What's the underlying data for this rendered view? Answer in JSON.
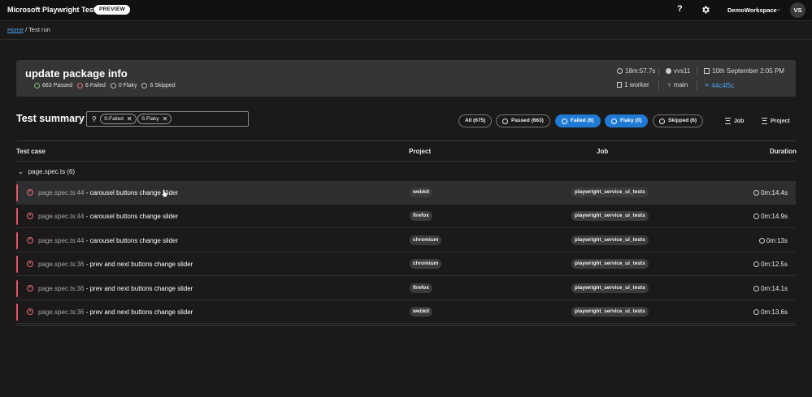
{
  "header": {
    "brand": "Microsoft Playwright Testing",
    "preview_badge": "PREVIEW",
    "help": "?",
    "workspace": "DemoWorkspace",
    "avatar": "VS"
  },
  "breadcrumb": {
    "home": "Home",
    "separator": "/",
    "current": "Test run"
  },
  "run": {
    "title": "update package info",
    "passed": "663 Passed",
    "failed": "6 Failed",
    "flaky": "0 Flaky",
    "skipped": "6 Skipped",
    "duration": "18m:57.7s",
    "user": "vvs11",
    "date": "10th September 2:05 PM",
    "workers": "1 worker",
    "branch": "main",
    "commit": "44c4f5c"
  },
  "summary": {
    "title": "Test summary",
    "filter_chips": [
      "S:Failed",
      "S:Flaky"
    ],
    "status_pills": [
      {
        "label": "All (675)",
        "active": false
      },
      {
        "label": "Passed (663)",
        "active": false
      },
      {
        "label": "Failed (6)",
        "active": true
      },
      {
        "label": "Flaky (0)",
        "active": true
      },
      {
        "label": "Skipped (6)",
        "active": false
      }
    ],
    "group_job": "Job",
    "group_project": "Project"
  },
  "table": {
    "headers": {
      "test_case": "Test case",
      "project": "Project",
      "job": "Job",
      "duration": "Duration"
    },
    "group_label": "page.spec.ts (6)",
    "rows": [
      {
        "file": "page.spec.ts:44",
        "sep": " - ",
        "title": "carousel buttons change slider",
        "project": "webkit",
        "job": "playwright_service_ui_tests",
        "duration": "0m:14.4s"
      },
      {
        "file": "page.spec.ts:44",
        "sep": " - ",
        "title": "carousel buttons change slider",
        "project": "firefox",
        "job": "playwright_service_ui_tests",
        "duration": "0m:14.9s"
      },
      {
        "file": "page.spec.ts:44",
        "sep": " - ",
        "title": "carousel buttons change slider",
        "project": "chromium",
        "job": "playwright_service_ui_tests",
        "duration": "0m:13s"
      },
      {
        "file": "page.spec.ts:36",
        "sep": " - ",
        "title": "prev and next buttons change slider",
        "project": "chromium",
        "job": "playwright_service_ui_tests",
        "duration": "0m:12.5s"
      },
      {
        "file": "page.spec.ts:36",
        "sep": " - ",
        "title": "prev and next buttons change slider",
        "project": "firefox",
        "job": "playwright_service_ui_tests",
        "duration": "0m:14.1s"
      },
      {
        "file": "page.spec.ts:36",
        "sep": " - ",
        "title": "prev and next buttons change slider",
        "project": "webkit",
        "job": "playwright_service_ui_tests",
        "duration": "0m:13.6s"
      }
    ]
  },
  "colors": {
    "accent": "#1f7ad6",
    "fail": "#e0556a",
    "link": "#4aa3f0"
  }
}
